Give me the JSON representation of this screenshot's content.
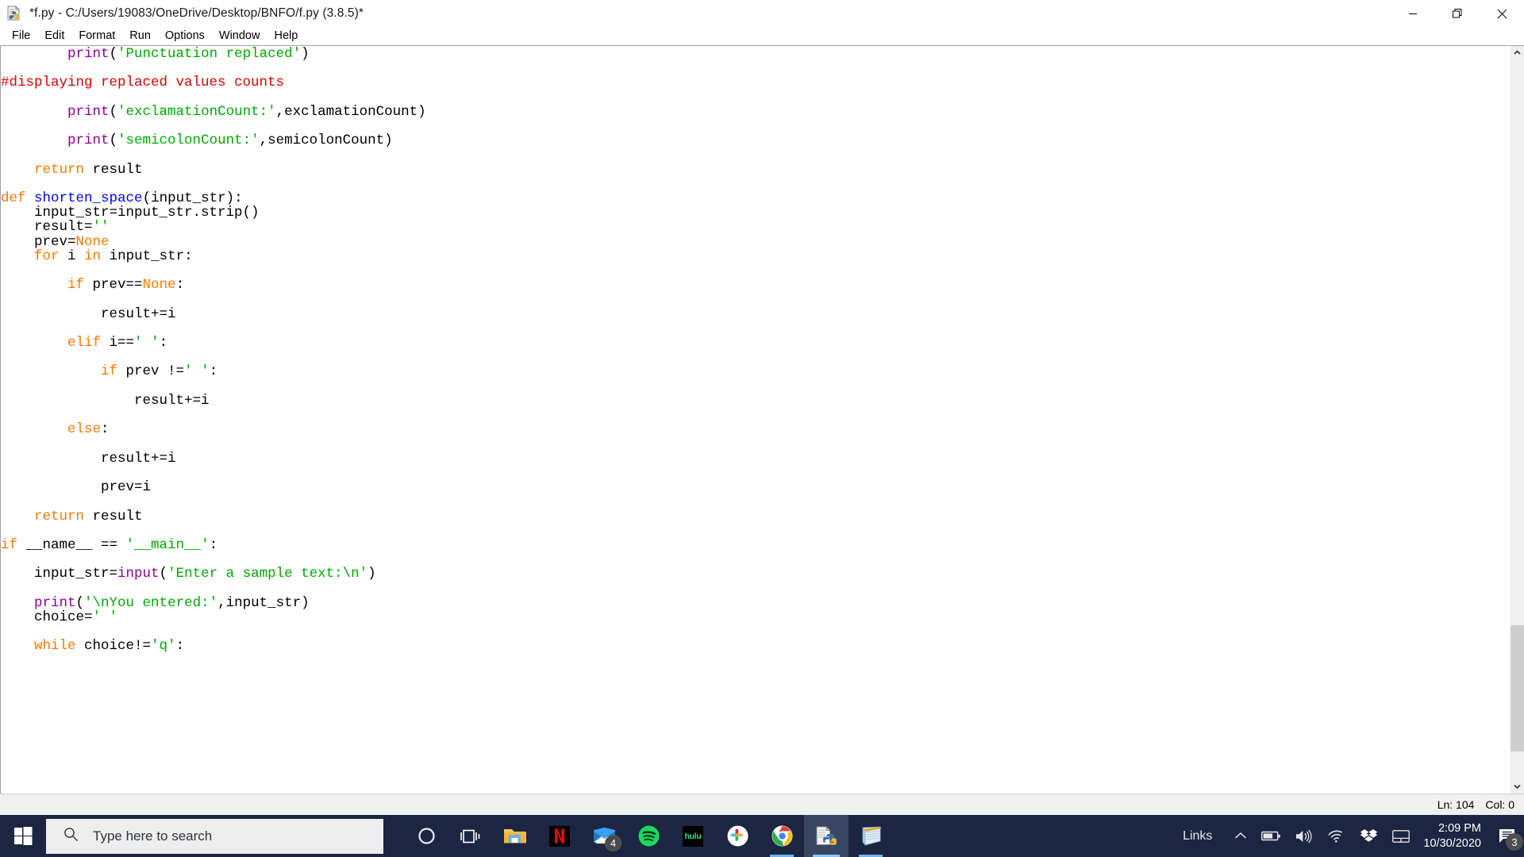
{
  "window": {
    "title": "*f.py - C:/Users/19083/OneDrive/Desktop/BNFO/f.py (3.8.5)*",
    "icon": "python-idle-icon",
    "controls": {
      "minimize": "minimize-icon",
      "restore": "restore-icon",
      "close": "close-icon"
    }
  },
  "menubar": {
    "items": [
      {
        "label": "File"
      },
      {
        "label": "Edit"
      },
      {
        "label": "Format"
      },
      {
        "label": "Run"
      },
      {
        "label": "Options"
      },
      {
        "label": "Window"
      },
      {
        "label": "Help"
      }
    ]
  },
  "editor": {
    "language": "python",
    "lines": [
      [
        {
          "t": "        ",
          "c": ""
        },
        {
          "t": "print",
          "c": "bi"
        },
        {
          "t": "(",
          "c": ""
        },
        {
          "t": "'Punctuation replaced'",
          "c": "str"
        },
        {
          "t": ")",
          "c": ""
        }
      ],
      [],
      [
        {
          "t": "#displaying replaced values counts",
          "c": "cmt"
        }
      ],
      [],
      [
        {
          "t": "        ",
          "c": ""
        },
        {
          "t": "print",
          "c": "bi"
        },
        {
          "t": "(",
          "c": ""
        },
        {
          "t": "'exclamationCount:'",
          "c": "str"
        },
        {
          "t": ",exclamationCount)",
          "c": ""
        }
      ],
      [],
      [
        {
          "t": "        ",
          "c": ""
        },
        {
          "t": "print",
          "c": "bi"
        },
        {
          "t": "(",
          "c": ""
        },
        {
          "t": "'semicolonCount:'",
          "c": "str"
        },
        {
          "t": ",semicolonCount)",
          "c": ""
        }
      ],
      [],
      [
        {
          "t": "    ",
          "c": ""
        },
        {
          "t": "return",
          "c": "kw"
        },
        {
          "t": " result",
          "c": ""
        }
      ],
      [],
      [
        {
          "t": "def",
          "c": "kw"
        },
        {
          "t": " ",
          "c": ""
        },
        {
          "t": "shorten_space",
          "c": "fn"
        },
        {
          "t": "(input_str):",
          "c": ""
        }
      ],
      [
        {
          "t": "    input_str=input_str.strip()",
          "c": ""
        }
      ],
      [
        {
          "t": "    result=",
          "c": ""
        },
        {
          "t": "''",
          "c": "str"
        }
      ],
      [
        {
          "t": "    prev=",
          "c": ""
        },
        {
          "t": "None",
          "c": "kw"
        }
      ],
      [
        {
          "t": "    ",
          "c": ""
        },
        {
          "t": "for",
          "c": "kw"
        },
        {
          "t": " i ",
          "c": ""
        },
        {
          "t": "in",
          "c": "kw"
        },
        {
          "t": " input_str:",
          "c": ""
        }
      ],
      [],
      [
        {
          "t": "        ",
          "c": ""
        },
        {
          "t": "if",
          "c": "kw"
        },
        {
          "t": " prev==",
          "c": ""
        },
        {
          "t": "None",
          "c": "kw"
        },
        {
          "t": ":",
          "c": ""
        }
      ],
      [],
      [
        {
          "t": "            result+=i",
          "c": ""
        }
      ],
      [],
      [
        {
          "t": "        ",
          "c": ""
        },
        {
          "t": "elif",
          "c": "kw"
        },
        {
          "t": " i==",
          "c": ""
        },
        {
          "t": "' '",
          "c": "str"
        },
        {
          "t": ":",
          "c": ""
        }
      ],
      [],
      [
        {
          "t": "            ",
          "c": ""
        },
        {
          "t": "if",
          "c": "kw"
        },
        {
          "t": " prev !=",
          "c": ""
        },
        {
          "t": "' '",
          "c": "str"
        },
        {
          "t": ":",
          "c": ""
        }
      ],
      [],
      [
        {
          "t": "                result+=i",
          "c": ""
        }
      ],
      [],
      [
        {
          "t": "        ",
          "c": ""
        },
        {
          "t": "else",
          "c": "kw"
        },
        {
          "t": ":",
          "c": ""
        }
      ],
      [],
      [
        {
          "t": "            result+=i",
          "c": ""
        }
      ],
      [],
      [
        {
          "t": "            prev=i",
          "c": ""
        }
      ],
      [],
      [
        {
          "t": "    ",
          "c": ""
        },
        {
          "t": "return",
          "c": "kw"
        },
        {
          "t": " result",
          "c": ""
        }
      ],
      [],
      [
        {
          "t": "if",
          "c": "kw"
        },
        {
          "t": " __name__ == ",
          "c": ""
        },
        {
          "t": "'__main__'",
          "c": "str"
        },
        {
          "t": ":",
          "c": ""
        }
      ],
      [],
      [
        {
          "t": "    input_str=",
          "c": ""
        },
        {
          "t": "input",
          "c": "bi"
        },
        {
          "t": "(",
          "c": ""
        },
        {
          "t": "'Enter a sample text:\\n'",
          "c": "str"
        },
        {
          "t": ")",
          "c": ""
        }
      ],
      [],
      [
        {
          "t": "    ",
          "c": ""
        },
        {
          "t": "print",
          "c": "bi"
        },
        {
          "t": "(",
          "c": ""
        },
        {
          "t": "'\\nYou entered:'",
          "c": "str"
        },
        {
          "t": ",input_str)",
          "c": ""
        }
      ],
      [
        {
          "t": "    choice=",
          "c": ""
        },
        {
          "t": "' '",
          "c": "str"
        }
      ],
      [],
      [
        {
          "t": "    ",
          "c": ""
        },
        {
          "t": "while",
          "c": "kw"
        },
        {
          "t": " choice!=",
          "c": ""
        },
        {
          "t": "'q'",
          "c": "str"
        },
        {
          "t": ":",
          "c": ""
        }
      ]
    ],
    "colors": {
      "keyword": "#ff7700",
      "definition": "#0000ff",
      "builtin": "#900090",
      "string": "#00aa00",
      "comment": "#dd0000",
      "text": "#000000",
      "background": "#ffffff"
    }
  },
  "statusbar": {
    "line_label": "Ln: 104",
    "col_label": "Col: 0"
  },
  "taskbar": {
    "start": "windows-start-icon",
    "search": {
      "placeholder": "Type here to search",
      "icon": "search-icon"
    },
    "icons": [
      {
        "name": "cortana-icon",
        "label": "Cortana",
        "badge": null,
        "active": false,
        "running": false
      },
      {
        "name": "task-view-icon",
        "label": "Task View",
        "badge": null,
        "active": false,
        "running": false
      },
      {
        "name": "file-explorer-icon",
        "label": "File Explorer",
        "badge": null,
        "active": false,
        "running": false
      },
      {
        "name": "netflix-icon",
        "label": "Netflix",
        "badge": null,
        "active": false,
        "running": false
      },
      {
        "name": "mail-icon",
        "label": "Mail",
        "badge": "4",
        "active": false,
        "running": false
      },
      {
        "name": "spotify-icon",
        "label": "Spotify",
        "badge": null,
        "active": false,
        "running": false
      },
      {
        "name": "hulu-icon",
        "label": "Hulu",
        "badge": null,
        "active": false,
        "running": false
      },
      {
        "name": "slack-icon",
        "label": "Slack",
        "badge": null,
        "active": false,
        "running": false
      },
      {
        "name": "chrome-icon",
        "label": "Google Chrome",
        "badge": null,
        "active": false,
        "running": true
      },
      {
        "name": "python-idle-icon",
        "label": "IDLE",
        "badge": null,
        "active": true,
        "running": true
      },
      {
        "name": "notepad-icon",
        "label": "Notepad",
        "badge": null,
        "active": false,
        "running": true
      }
    ],
    "tray": {
      "links_label": "Links",
      "chevron": "chevron-up-icon",
      "items": [
        {
          "name": "battery-icon"
        },
        {
          "name": "volume-icon"
        },
        {
          "name": "wifi-icon"
        },
        {
          "name": "dropbox-icon"
        },
        {
          "name": "touchpad-icon"
        }
      ],
      "time": "2:09 PM",
      "date": "10/30/2020",
      "action_center": {
        "icon": "action-center-icon",
        "badge": "3"
      }
    }
  }
}
